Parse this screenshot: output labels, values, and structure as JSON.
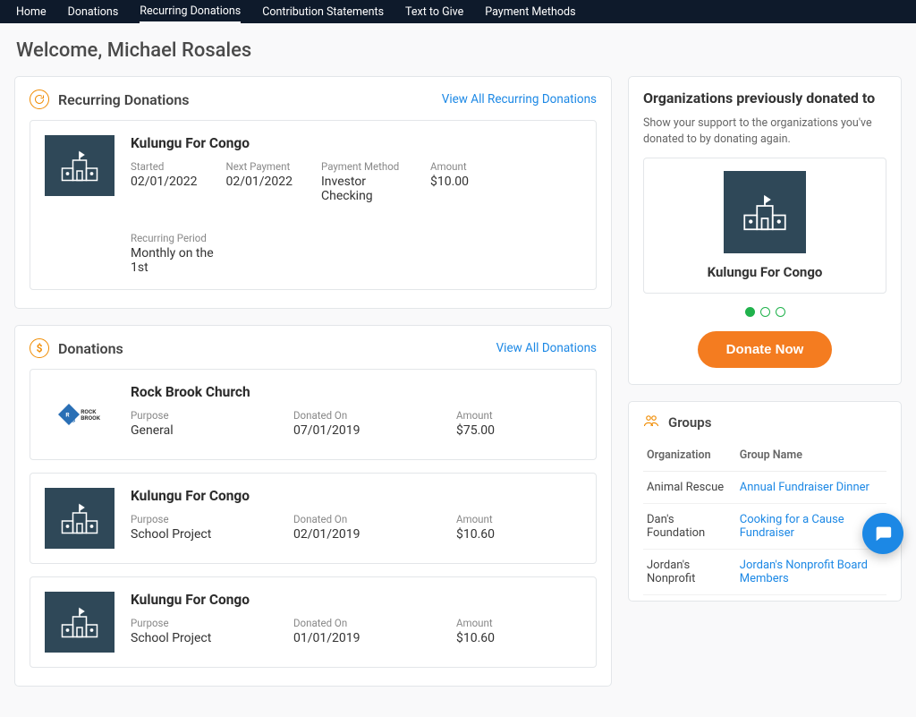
{
  "nav": {
    "items": [
      "Home",
      "Donations",
      "Recurring Donations",
      "Contribution Statements",
      "Text to Give",
      "Payment Methods"
    ],
    "active_index": 2
  },
  "welcome": "Welcome, Michael Rosales",
  "recurring": {
    "title": "Recurring Donations",
    "view_all": "View All Recurring Donations",
    "items": [
      {
        "name": "Kulungu For Congo",
        "started_label": "Started",
        "started": "02/01/2022",
        "next_label": "Next Payment",
        "next": "02/01/2022",
        "method_label": "Payment Method",
        "method": "Investor Checking",
        "amount_label": "Amount",
        "amount": "$10.00",
        "period_label": "Recurring Period",
        "period": "Monthly on the 1st"
      }
    ]
  },
  "donations": {
    "title": "Donations",
    "view_all": "View All Donations",
    "items": [
      {
        "name": "Rock Brook Church",
        "logo": "rb",
        "purpose_label": "Purpose",
        "purpose": "General",
        "donated_label": "Donated On",
        "donated": "07/01/2019",
        "amount_label": "Amount",
        "amount": "$75.00"
      },
      {
        "name": "Kulungu For Congo",
        "logo": "building",
        "purpose_label": "Purpose",
        "purpose": "School Project",
        "donated_label": "Donated On",
        "donated": "02/01/2019",
        "amount_label": "Amount",
        "amount": "$10.60"
      },
      {
        "name": "Kulungu For Congo",
        "logo": "building",
        "purpose_label": "Purpose",
        "purpose": "School Project",
        "donated_label": "Donated On",
        "donated": "01/01/2019",
        "amount_label": "Amount",
        "amount": "$10.60"
      }
    ]
  },
  "sidebar": {
    "prev_orgs_title": "Organizations previously donated to",
    "prev_orgs_sub": "Show your support to the organizations you've donated to by donating again.",
    "featured_org": "Kulungu For Congo",
    "donate_label": "Donate Now",
    "carousel_count": 3,
    "carousel_active": 0,
    "groups_title": "Groups",
    "groups_headers": [
      "Organization",
      "Group Name"
    ],
    "groups": [
      {
        "org": "Animal Rescue",
        "group": "Annual Fundraiser Dinner"
      },
      {
        "org": "Dan's Foundation",
        "group": "Cooking for a Cause Fundraiser"
      },
      {
        "org": "Jordan's Nonprofit",
        "group": "Jordan's Nonprofit Board Members"
      }
    ]
  }
}
